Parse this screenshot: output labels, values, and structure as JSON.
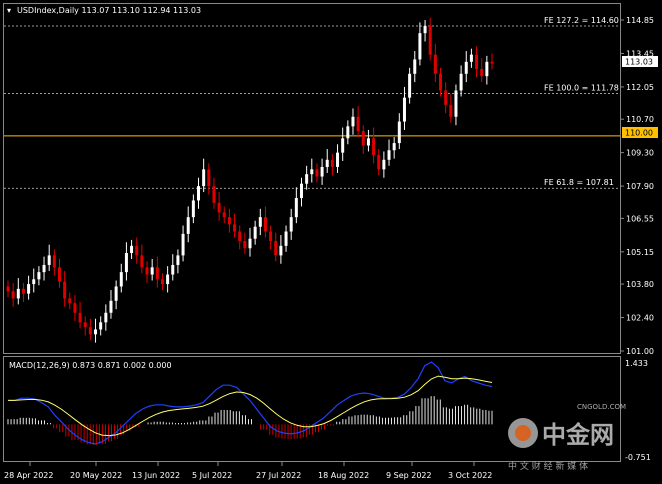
{
  "header": {
    "symbol_line": "USDIndex,Daily  113.07 113.10 112.94 113.03"
  },
  "macd": {
    "label": "MACD(12,26,9) 0.873 0.871 0.002 0.000",
    "top_value": "1.433",
    "bottom_value": "-0.751"
  },
  "fib_levels": [
    {
      "label": "FE 127.2 = 114.60",
      "price": 114.6
    },
    {
      "label": "FE 100.0 = 111.78",
      "price": 111.78
    },
    {
      "label": "FE 61.8 = 107.81",
      "price": 107.81
    }
  ],
  "horizontal_line": {
    "price": 110.0,
    "label": "110.00",
    "color": "#ffc000"
  },
  "current_price": {
    "price": 113.03,
    "label": "113.03"
  },
  "price_axis_labels": [
    "114.85",
    "113.45",
    "112.05",
    "110.70",
    "109.30",
    "107.90",
    "106.55",
    "105.15",
    "103.80",
    "102.40",
    "101.00"
  ],
  "date_axis_labels": [
    "28 Apr 2022",
    "20 May 2022",
    "13 Jun 2022",
    "5 Jul 2022",
    "27 Jul 2022",
    "18 Aug 2022",
    "9 Sep 2022",
    "3 Oct 2022"
  ],
  "watermark": {
    "brand_cn": "中金网",
    "brand_en": "CNGOLD.COM",
    "tagline": "中 文 财 经 新 媒 体"
  },
  "colors": {
    "bull": "#ffffff",
    "bear": "#e00000",
    "signal": "#ffff66",
    "macd_line": "#2040ff"
  },
  "chart_data": {
    "type": "candlestick",
    "price_range": [
      101.0,
      114.85
    ],
    "closes_approx": [
      103.5,
      103.2,
      103.6,
      103.4,
      103.8,
      104.0,
      104.3,
      104.6,
      105.0,
      104.5,
      103.9,
      103.2,
      103.0,
      102.6,
      102.2,
      102.0,
      101.7,
      101.9,
      102.2,
      102.6,
      103.1,
      103.7,
      104.3,
      105.1,
      105.4,
      105.0,
      104.5,
      104.2,
      104.5,
      104.0,
      103.8,
      104.2,
      104.6,
      105.0,
      105.9,
      106.6,
      107.3,
      107.9,
      108.6,
      107.9,
      107.2,
      106.8,
      106.6,
      106.3,
      106.0,
      105.6,
      105.3,
      105.7,
      106.2,
      106.6,
      106.0,
      105.6,
      105.0,
      105.4,
      106.0,
      106.6,
      107.4,
      108.0,
      108.4,
      108.6,
      108.3,
      108.7,
      109.0,
      108.7,
      109.3,
      109.9,
      110.4,
      110.8,
      110.2,
      109.6,
      109.9,
      109.2,
      108.6,
      109.0,
      109.4,
      109.7,
      110.6,
      111.6,
      112.6,
      113.2,
      114.3,
      114.6,
      113.4,
      112.6,
      111.9,
      111.3,
      110.8,
      111.9,
      112.6,
      113.1,
      113.4,
      112.8,
      112.5,
      113.1,
      113.03
    ],
    "macd_approx": [
      0.55,
      0.55,
      0.6,
      0.6,
      0.58,
      0.5,
      0.4,
      0.2,
      0.05,
      -0.12,
      -0.25,
      -0.35,
      -0.42,
      -0.45,
      -0.4,
      -0.3,
      -0.2,
      -0.05,
      0.1,
      0.25,
      0.35,
      0.42,
      0.45,
      0.45,
      0.42,
      0.4,
      0.4,
      0.42,
      0.45,
      0.5,
      0.65,
      0.8,
      0.9,
      0.9,
      0.85,
      0.7,
      0.55,
      0.35,
      0.15,
      -0.05,
      -0.15,
      -0.2,
      -0.22,
      -0.2,
      -0.15,
      -0.05,
      0.05,
      0.15,
      0.3,
      0.45,
      0.55,
      0.65,
      0.7,
      0.72,
      0.7,
      0.65,
      0.6,
      0.6,
      0.62,
      0.7,
      0.85,
      1.05,
      1.35,
      1.43,
      1.3,
      1.0,
      0.95,
      1.05,
      1.1,
      1.0,
      0.95,
      0.9,
      0.87
    ]
  }
}
